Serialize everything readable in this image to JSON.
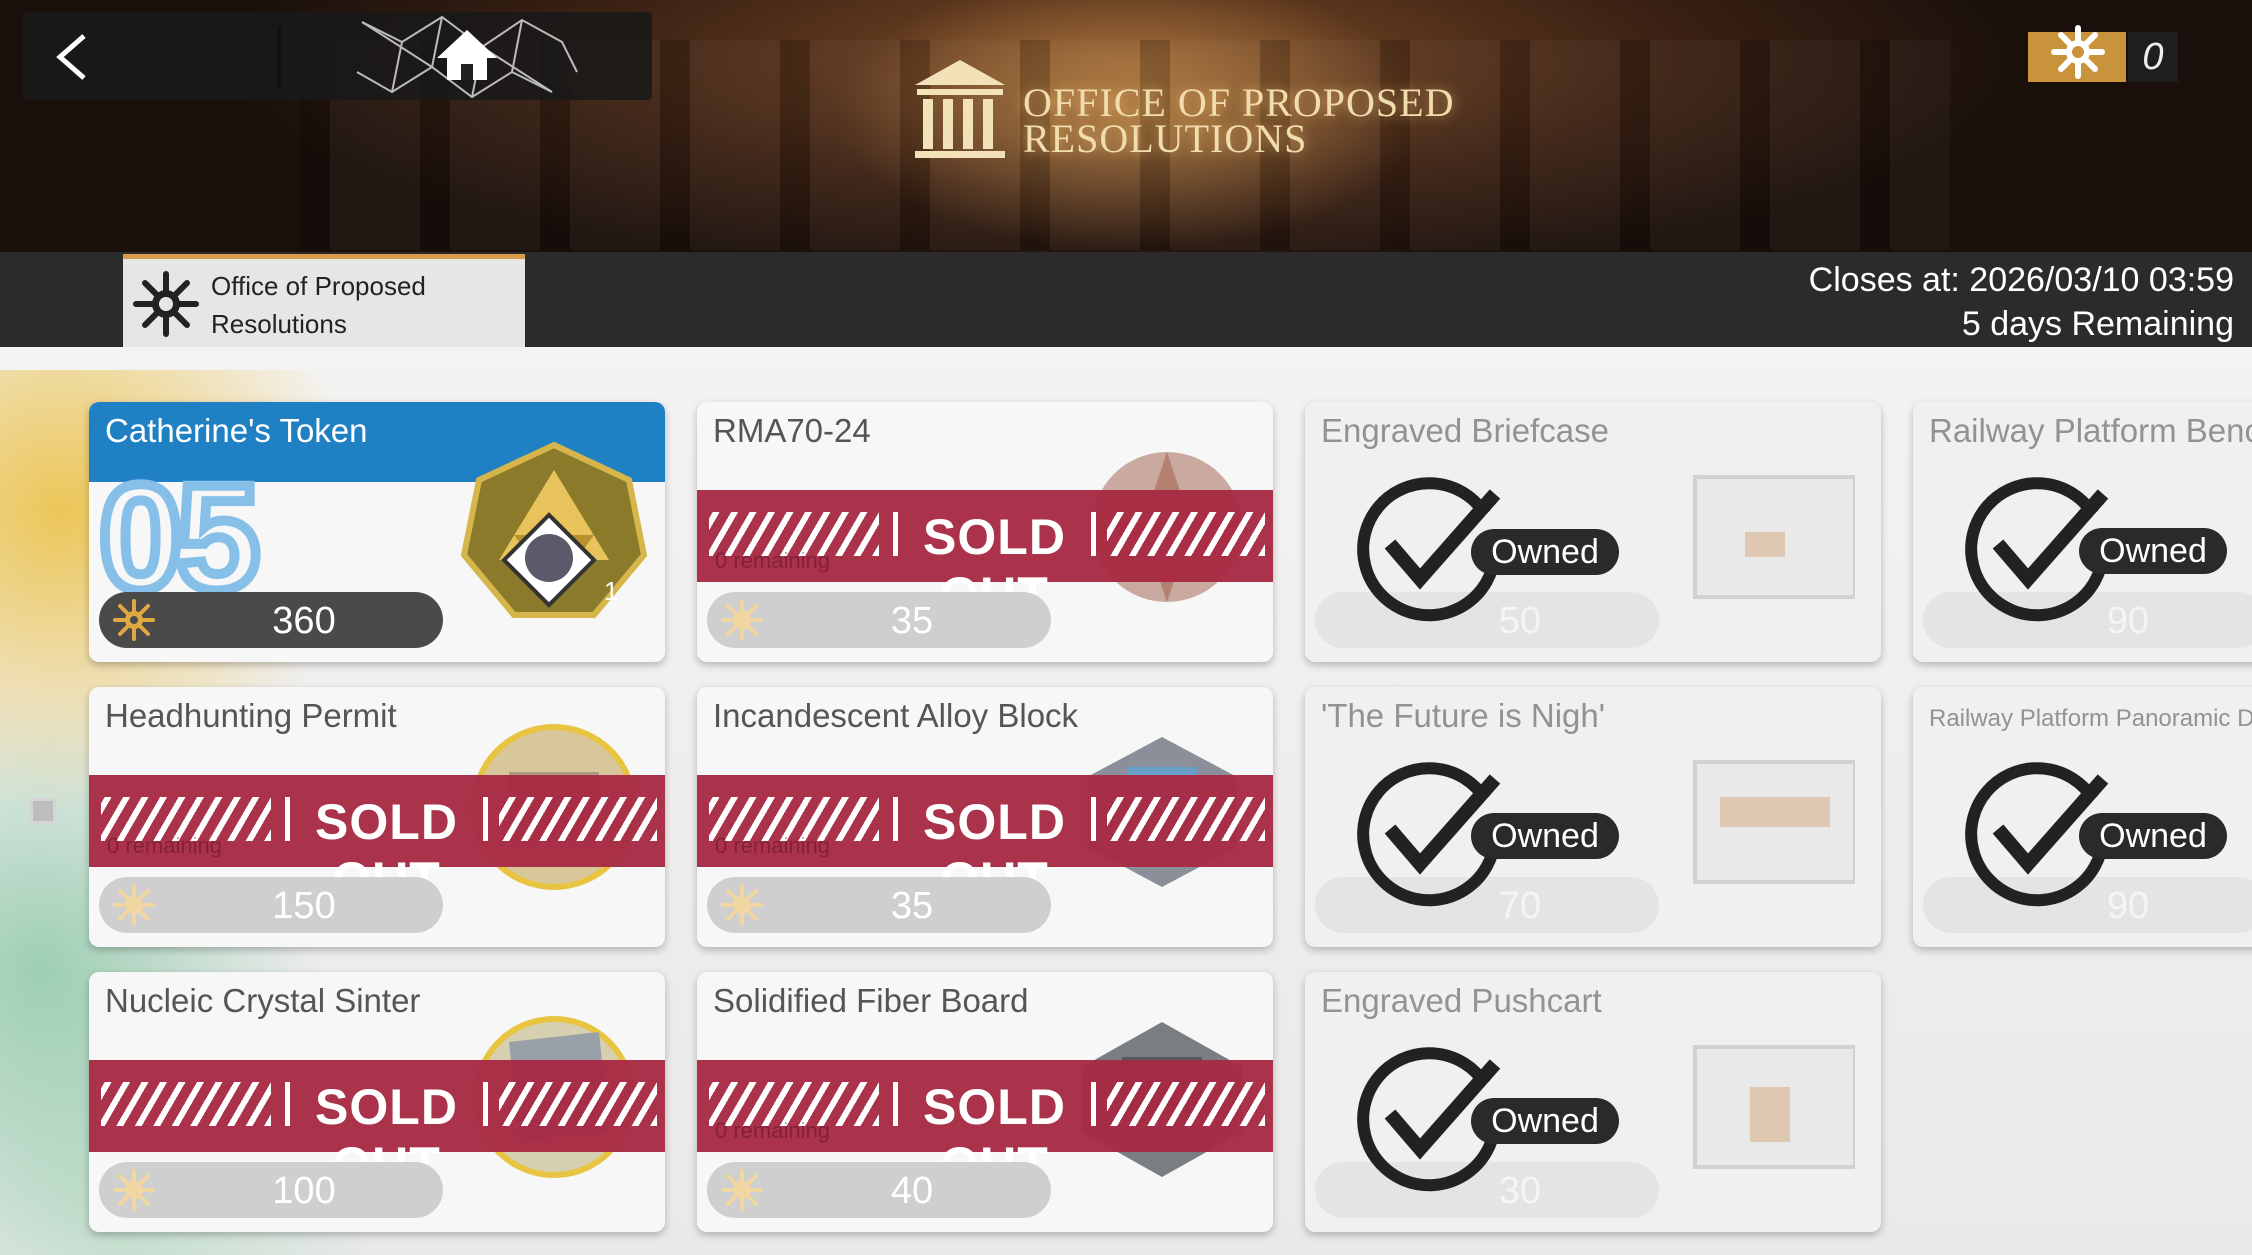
{
  "header": {
    "title_line1": "OFFICE OF PROPOSED",
    "title_line2": "RESOLUTIONS",
    "currency_count": "0"
  },
  "tab": {
    "label_line1": "Office of Proposed",
    "label_line2": "Resolutions"
  },
  "timer": {
    "closes_at": "Closes at: 2026/03/10 03:59",
    "remaining": "5 days Remaining"
  },
  "featured": {
    "name": "Catherine's Token",
    "big_number": "05",
    "price": "360",
    "quantity": "1"
  },
  "sold_out_label": "SOLD OUT",
  "sold_out_remaining": "0 remaining",
  "sold_out_items": [
    {
      "name": "RMA70-24",
      "price": "35"
    },
    {
      "name": "Headhunting Permit",
      "price": "150"
    },
    {
      "name": "Incandescent Alloy Block",
      "price": "35"
    },
    {
      "name": "Nucleic Crystal Sinter",
      "price": "100"
    },
    {
      "name": "Solidified Fiber Board",
      "price": "40"
    }
  ],
  "owned_label": "Owned",
  "owned_items": [
    {
      "name": "Engraved Briefcase",
      "price": "50"
    },
    {
      "name": "Railway Platform Bench",
      "price": "90"
    },
    {
      "name": "'The Future is Nigh'",
      "price": "70"
    },
    {
      "name": "Railway Platform Panoramic Disp",
      "price": "90"
    },
    {
      "name": "Engraved Pushcart",
      "price": "30"
    }
  ],
  "colors": {
    "accent_blue": "#1f80c4",
    "sold_out_red": "#a82a44",
    "gold": "#c9933c"
  }
}
